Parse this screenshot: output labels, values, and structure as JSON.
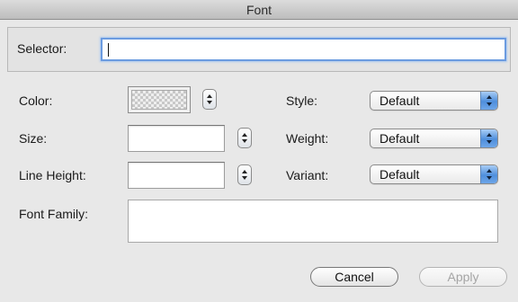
{
  "window": {
    "title": "Font"
  },
  "selector": {
    "label": "Selector:",
    "value": ""
  },
  "color": {
    "label": "Color:"
  },
  "size": {
    "label": "Size:",
    "value": ""
  },
  "line_height": {
    "label": "Line Height:",
    "value": ""
  },
  "style": {
    "label": "Style:",
    "selected": "Default"
  },
  "weight": {
    "label": "Weight:",
    "selected": "Default"
  },
  "variant": {
    "label": "Variant:",
    "selected": "Default"
  },
  "font_family": {
    "label": "Font Family:",
    "value": ""
  },
  "buttons": {
    "cancel": "Cancel",
    "apply": "Apply"
  },
  "colors": {
    "focus_ring": "#6b9be0",
    "popup_accent": "#4f8fdc",
    "disabled_text": "#a5a5a5"
  }
}
